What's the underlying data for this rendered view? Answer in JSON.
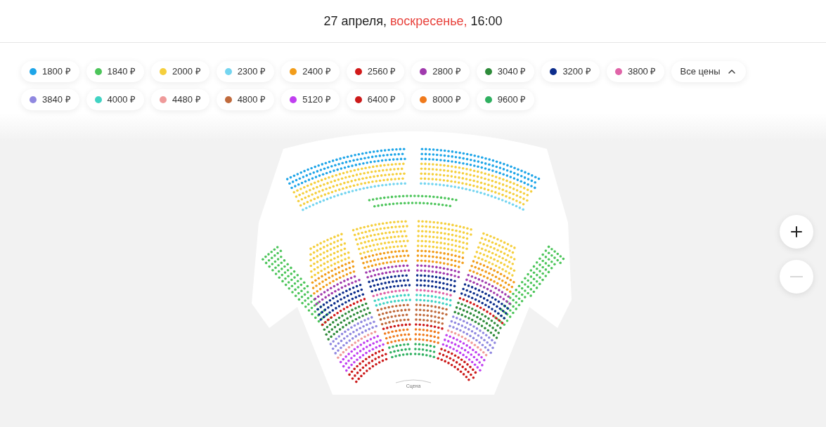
{
  "header": {
    "date": "27 апреля,",
    "weekday": "воскресенье,",
    "time": "16:00"
  },
  "prices": [
    {
      "label": "1800 ₽",
      "color": "#1ea5e8"
    },
    {
      "label": "1840 ₽",
      "color": "#4cc55a"
    },
    {
      "label": "2000 ₽",
      "color": "#f5cf3d"
    },
    {
      "label": "2300 ₽",
      "color": "#74d5f0"
    },
    {
      "label": "2400 ₽",
      "color": "#f29d1a"
    },
    {
      "label": "2560 ₽",
      "color": "#d21a1a"
    },
    {
      "label": "2800 ₽",
      "color": "#a03aad"
    },
    {
      "label": "3040 ₽",
      "color": "#2e8b3a"
    },
    {
      "label": "3200 ₽",
      "color": "#0d2d8c"
    },
    {
      "label": "3800 ₽",
      "color": "#e064a8"
    },
    {
      "label": "3840 ₽",
      "color": "#9088e0"
    },
    {
      "label": "4000 ₽",
      "color": "#40d3c3"
    },
    {
      "label": "4480 ₽",
      "color": "#ef9a9a"
    },
    {
      "label": "4800 ₽",
      "color": "#c06a3c"
    },
    {
      "label": "5120 ₽",
      "color": "#c03ff0"
    },
    {
      "label": "6400 ₽",
      "color": "#cc1a1a"
    },
    {
      "label": "8000 ₽",
      "color": "#f07a1c"
    },
    {
      "label": "9600 ₽",
      "color": "#2fb060"
    }
  ],
  "all_prices": {
    "label": "Все цены",
    "expanded": true
  },
  "seat_map": {
    "stage_label": "Сцена"
  },
  "zoom": [
    {
      "kind": "zoom-in",
      "disabled": false
    },
    {
      "kind": "zoom-out",
      "disabled": true
    }
  ]
}
